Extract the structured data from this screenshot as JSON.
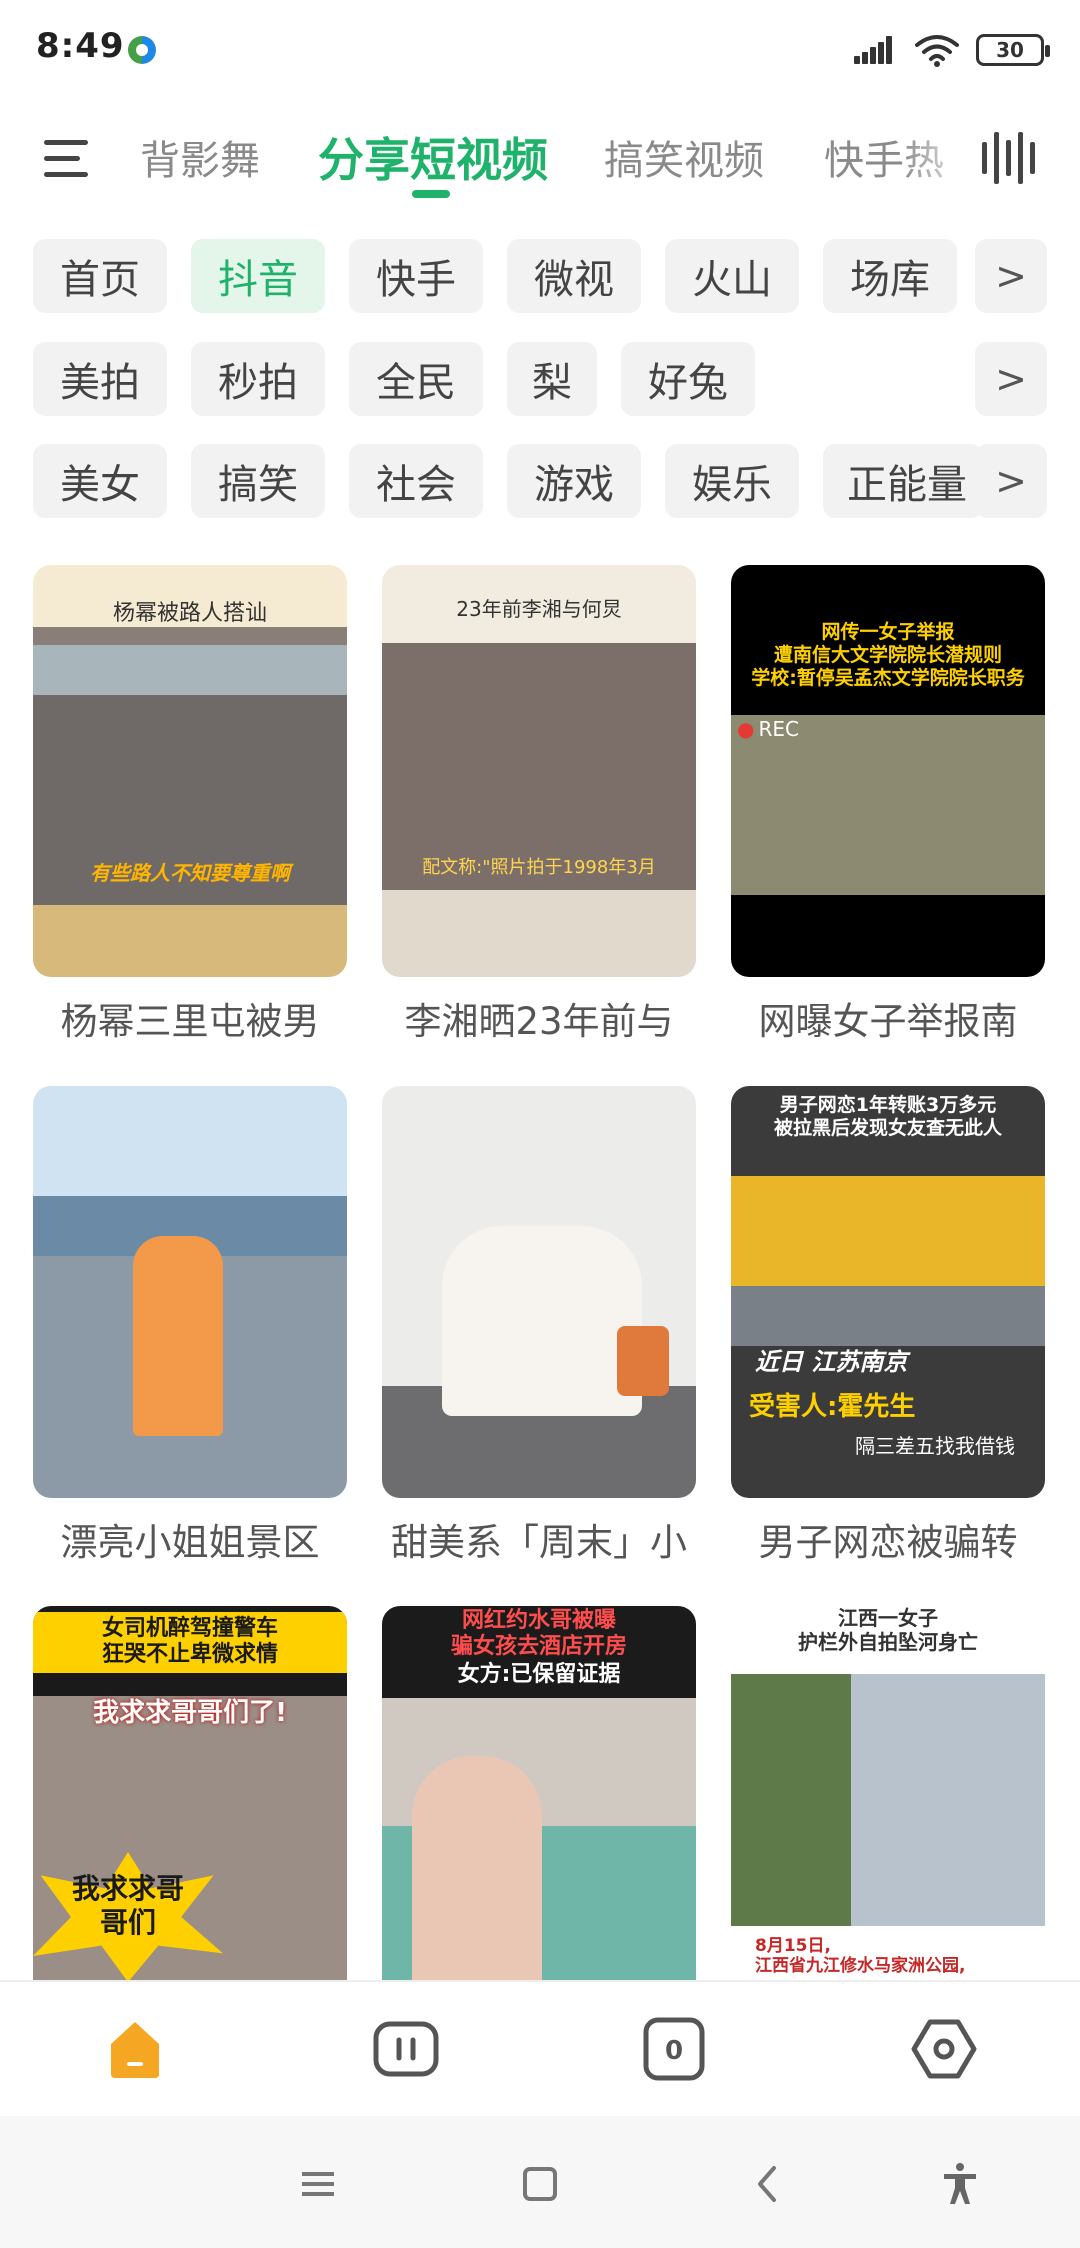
{
  "status_bar": {
    "time": "8:49",
    "battery": "30"
  },
  "top_tabs": [
    "背影舞",
    "分享短视频",
    "搞笑视频",
    "快手热"
  ],
  "chip_rows": [
    [
      "首页",
      "抖音",
      "快手",
      "微视",
      "火山",
      "场库"
    ],
    [
      "美拍",
      "秒拍",
      "全民",
      "梨",
      "好兔"
    ],
    [
      "美女",
      "搞笑",
      "社会",
      "游戏",
      "娱乐",
      "正能量"
    ]
  ],
  "more_label": ">",
  "videos": [
    {
      "caption": "杨幂三里屯被男",
      "overlay_top": "杨幂被路人搭讪",
      "overlay_bottom": "有些路人不知要尊重啊"
    },
    {
      "caption": "李湘晒23年前与",
      "overlay_top": "23年前李湘与何炅",
      "overlay_bottom": "配文称:\"照片拍于1998年3月"
    },
    {
      "caption": "网曝女子举报南",
      "overlay_top": "网传一女子举报\n遭南信大文学院院长潜规则\n学校:暂停吴孟杰文学院院长职务",
      "overlay_rec": "REC"
    },
    {
      "caption": "漂亮小姐姐景区"
    },
    {
      "caption": "甜美系「周末」小"
    },
    {
      "caption": "男子网恋被骗转",
      "overlay_top": "男子网恋1年转账3万多元\n被拉黑后发现女友查无此人",
      "overlay_mid": "近日 江苏南京",
      "overlay_victim": "受害人:霍先生",
      "overlay_note": "隔三差五找我借钱"
    },
    {
      "caption": "",
      "overlay_top": "女司机醉驾撞警车\n狂哭不止卑微求情",
      "overlay_mid": "我求求哥哥们了!",
      "overlay_bottom": "我求求哥\n哥们"
    },
    {
      "caption": "",
      "overlay_top": "网红约水哥被曝\n骗女孩去酒店开房",
      "overlay_mid": "女方:已保留证据"
    },
    {
      "caption": "",
      "overlay_top": "江西一女子\n护栏外自拍坠河身亡",
      "overlay_bottom": "8月15日,\n江西省九江修水马家洲公园,"
    }
  ],
  "colors": {
    "accent": "#1fb26a",
    "home_icon": "#f5a623"
  },
  "nav_icons": [
    "home-icon",
    "pause-icon",
    "zero-badge-icon",
    "settings-icon"
  ],
  "system_icons": [
    "menu-icon",
    "home-square-icon",
    "back-icon",
    "accessibility-icon"
  ]
}
